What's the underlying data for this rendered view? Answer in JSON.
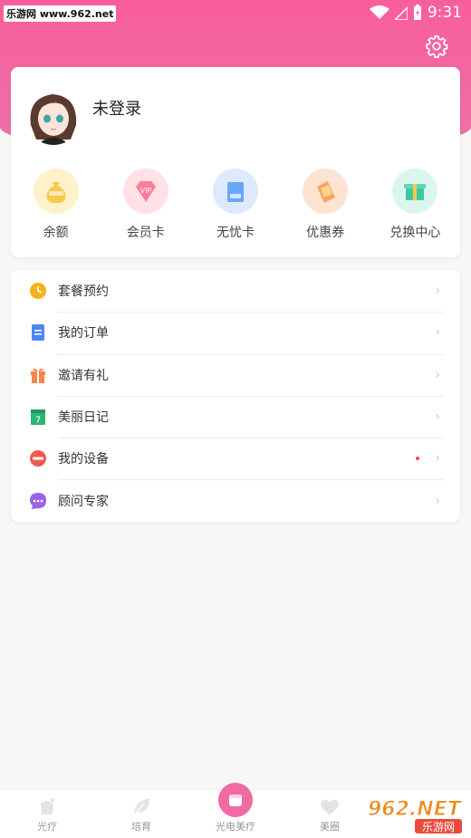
{
  "status": {
    "watermark": "乐游网 www.962.net",
    "time": "9:31"
  },
  "profile": {
    "login_text": "未登录"
  },
  "quick_actions": [
    {
      "label": "余额",
      "icon": "money-bag-icon",
      "bg": "#fff1c9"
    },
    {
      "label": "会员卡",
      "icon": "vip-diamond-icon",
      "bg": "#ffe1e6"
    },
    {
      "label": "无忧卡",
      "icon": "card-icon",
      "bg": "#dde9ff"
    },
    {
      "label": "优惠券",
      "icon": "coupon-icon",
      "bg": "#ffe3d2"
    },
    {
      "label": "兑换中心",
      "icon": "exchange-box-icon",
      "bg": "#dbf6ee"
    }
  ],
  "menu": [
    {
      "label": "套餐预约",
      "icon": "clock-icon",
      "color": "#f7b21a"
    },
    {
      "label": "我的订单",
      "icon": "order-doc-icon",
      "color": "#4c86f5"
    },
    {
      "label": "邀请有礼",
      "icon": "gift-icon",
      "color": "#f7864a"
    },
    {
      "label": "美丽日记",
      "icon": "calendar-icon",
      "color": "#2bb673",
      "calendar_day": "7"
    },
    {
      "label": "我的设备",
      "icon": "device-icon",
      "color": "#ef5a4f"
    },
    {
      "label": "顾问专家",
      "icon": "chat-bubble-icon",
      "color": "#9a63e8"
    }
  ],
  "bottom_nav": [
    {
      "label": "光疗",
      "icon": "light-therapy-icon"
    },
    {
      "label": "培育",
      "icon": "leaf-icon"
    },
    {
      "label": "光电美疗",
      "icon": "beauty-device-icon"
    },
    {
      "label": "美圈",
      "icon": "heart-icon"
    },
    {
      "label": "",
      "icon": ""
    }
  ],
  "watermark_logo": {
    "text": "962.NET",
    "subtext": "乐游网"
  },
  "colors": {
    "accent": "#f06aa3",
    "header": "#f95e9c"
  }
}
